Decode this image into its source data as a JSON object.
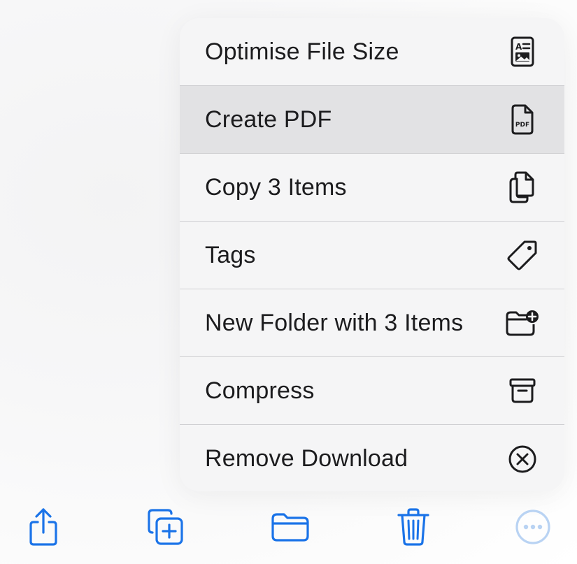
{
  "menu": {
    "items": [
      {
        "label": "Optimise File Size",
        "icon": "optimise-file-icon"
      },
      {
        "label": "Create PDF",
        "icon": "pdf-doc-icon",
        "highlighted": true
      },
      {
        "label": "Copy 3 Items",
        "icon": "copy-docs-icon"
      },
      {
        "label": "Tags",
        "icon": "tag-icon"
      },
      {
        "label": "New Folder with 3 Items",
        "icon": "folder-plus-icon"
      },
      {
        "label": "Compress",
        "icon": "archive-box-icon"
      },
      {
        "label": "Remove Download",
        "icon": "x-circle-icon"
      }
    ],
    "pdf_icon_text": "PDF"
  },
  "toolbar": {
    "icons": [
      "share-icon",
      "duplicate-icon",
      "folder-icon",
      "trash-icon",
      "more-icon"
    ]
  },
  "colors": {
    "accent": "#1a73e8",
    "accent_disabled": "#b9d3f3",
    "menu_background": "#f5f5f6",
    "menu_highlight": "#e2e2e4",
    "text": "#1c1c1e",
    "separator": "#cfcfd2"
  }
}
